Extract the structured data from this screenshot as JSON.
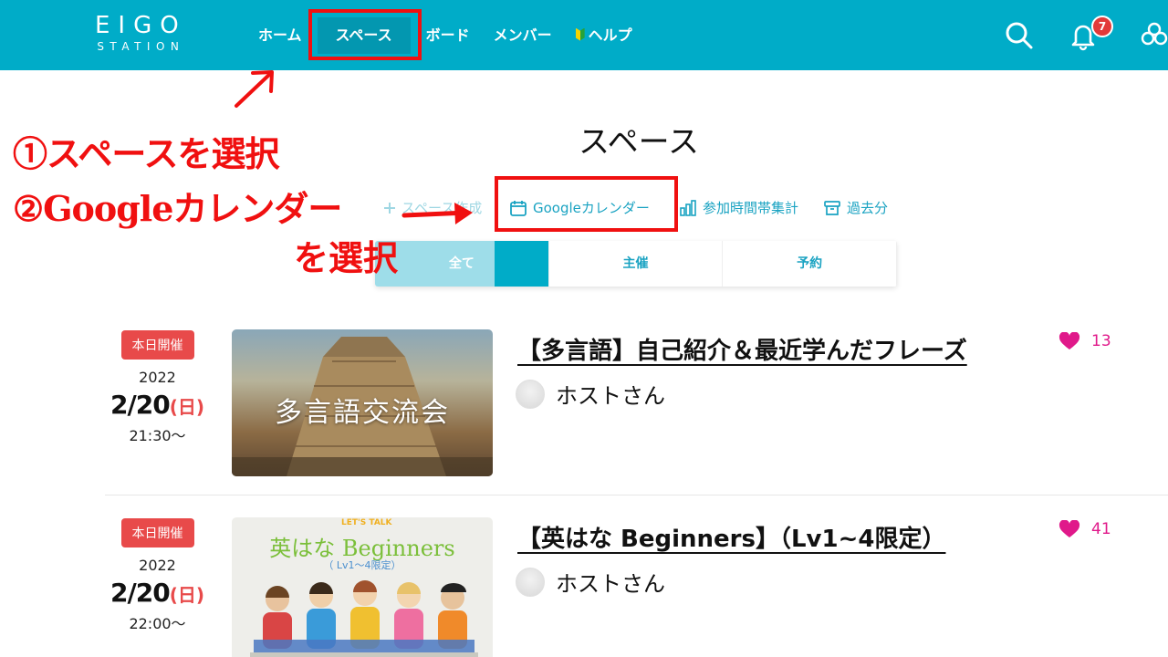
{
  "header": {
    "logo_top": "EIGO",
    "logo_bottom": "STATION",
    "nav": [
      "ホーム",
      "スペース",
      "ボード",
      "メンバー",
      "ヘルプ"
    ],
    "notification_count": "7",
    "icons": [
      "search-icon",
      "bell-icon",
      "app-logo-icon"
    ],
    "bg_color": "#00acc8"
  },
  "annotations": {
    "step1": "①スペースを選択",
    "step2": "②Googleカレンダー",
    "step2b": "を選択",
    "color": "#f01010"
  },
  "page": {
    "title": "スペース",
    "tools": {
      "create": "スペース作成",
      "gcal": "Googleカレンダー",
      "stats": "参加時間帯集計",
      "past": "過去分"
    },
    "tabs": [
      "全て",
      "主催",
      "予約"
    ]
  },
  "events": [
    {
      "badge": "本日開催",
      "year": "2022",
      "date": "2/20",
      "dow": "(日)",
      "time": "21:30〜",
      "thumb_text": "多言語交流会",
      "title": "【多言語】自己紹介＆最近学んだフレーズ",
      "host": "ホストさん",
      "likes": "13"
    },
    {
      "badge": "本日開催",
      "year": "2022",
      "date": "2/20",
      "dow": "(日)",
      "time": "22:00〜",
      "thumb_lets": "LET'S TALK",
      "thumb_title": "英はな Beginners",
      "thumb_sub": "（ Lv1〜4限定）",
      "title": "【英はな Beginners】（Lv1~4限定）",
      "host": "ホストさん",
      "likes": "41"
    }
  ]
}
